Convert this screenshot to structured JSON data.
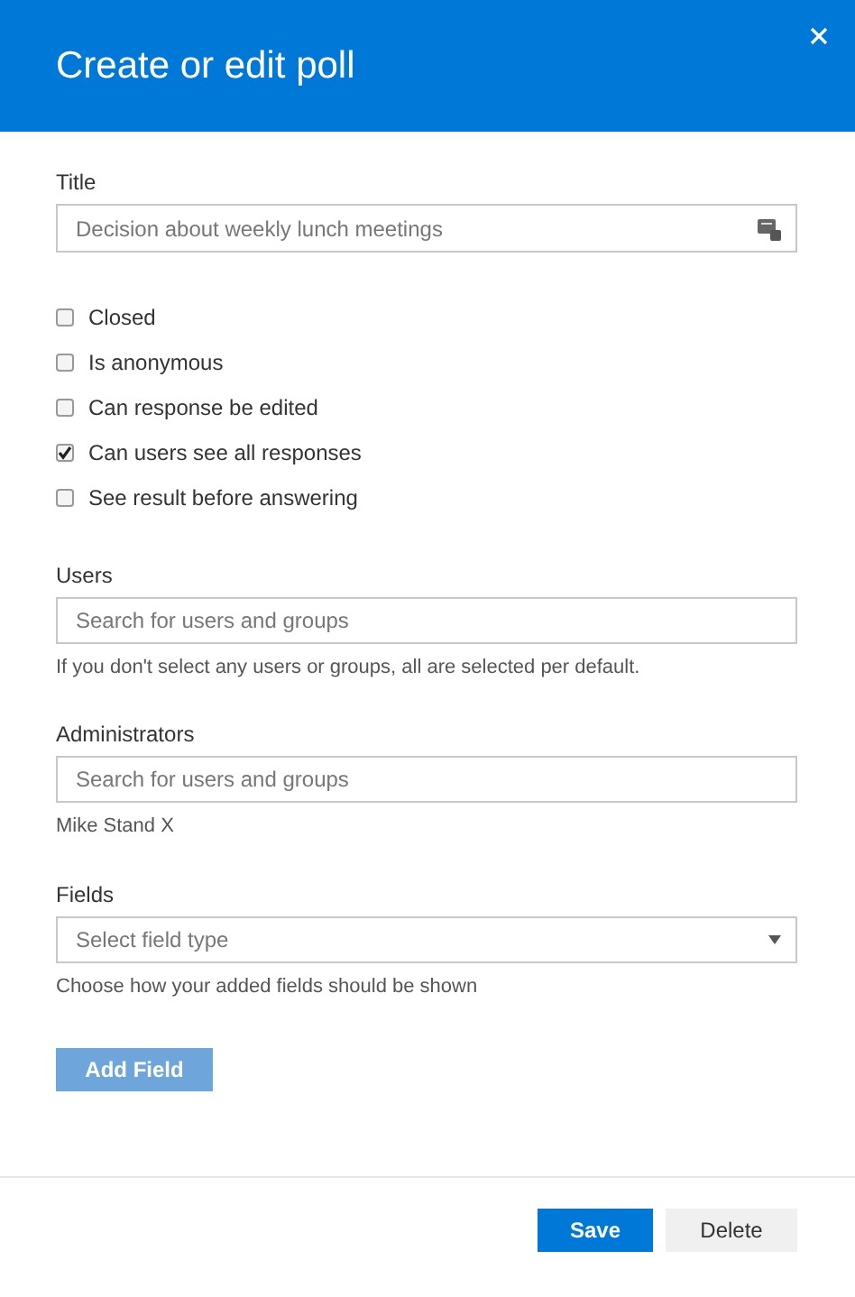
{
  "dialog": {
    "title": "Create or edit poll"
  },
  "title_field": {
    "label": "Title",
    "placeholder": "Decision about weekly lunch meetings"
  },
  "options": [
    {
      "label": "Closed",
      "checked": false
    },
    {
      "label": "Is anonymous",
      "checked": false
    },
    {
      "label": "Can response be edited",
      "checked": false
    },
    {
      "label": "Can users see all responses",
      "checked": true
    },
    {
      "label": "See result before answering",
      "checked": false
    }
  ],
  "users": {
    "label": "Users",
    "placeholder": "Search for users and groups",
    "help": "If you don't select any users or groups, all are selected per default."
  },
  "administrators": {
    "label": "Administrators",
    "placeholder": "Search for users and groups",
    "selected_users": [
      "Mike Stand X"
    ]
  },
  "fields": {
    "label": "Fields",
    "placeholder": "Select field type",
    "help": "Choose how your added fields should be shown"
  },
  "add_field_button": {
    "label": "Add Field",
    "disabled": true
  },
  "footer_buttons": [
    {
      "label": "Save",
      "kind": "primary"
    },
    {
      "label": "Delete",
      "kind": "secondary"
    }
  ]
}
